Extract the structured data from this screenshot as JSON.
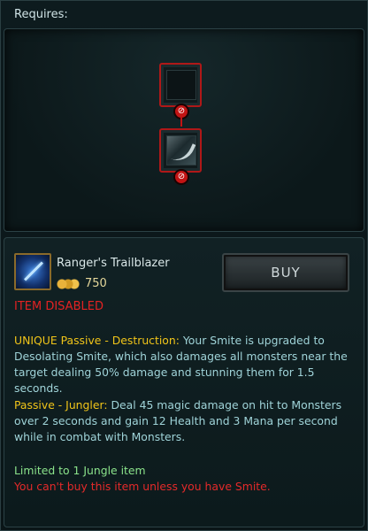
{
  "header": {
    "requires_label": "Requires:"
  },
  "recipe": {
    "slots": [
      {
        "name": "empty-slot",
        "icon": "empty-item-icon",
        "status": "unavailable"
      },
      {
        "name": "hunters-talisman-slot",
        "icon": "talon-icon",
        "status": "unavailable"
      }
    ],
    "status_icon": "no-entry-icon"
  },
  "item": {
    "icon": "sword-icon",
    "name": "Ranger's Trailblazer",
    "price": "750",
    "buy_label": "BUY",
    "disabled_label": "ITEM DISABLED",
    "passive1": {
      "title": "UNIQUE Passive - Destruction:",
      "text": "Your Smite is upgraded to Desolating Smite, which also damages all monsters near the target dealing 50% damage and stunning them for 1.5 seconds."
    },
    "passive2": {
      "title": "Passive - Jungler:",
      "text": "Deal 45 magic damage on hit to Monsters over 2 seconds and gain 12 Health and 3 Mana per second while in combat with Monsters."
    },
    "limit_text": "Limited to 1 Jungle item",
    "warning_text": "You can't buy this item unless you have Smite."
  },
  "colors": {
    "accent_gold": "#f0c419",
    "disabled_red": "#e42222",
    "limit_green": "#8be38b",
    "description_teal": "#9fd3d8"
  }
}
